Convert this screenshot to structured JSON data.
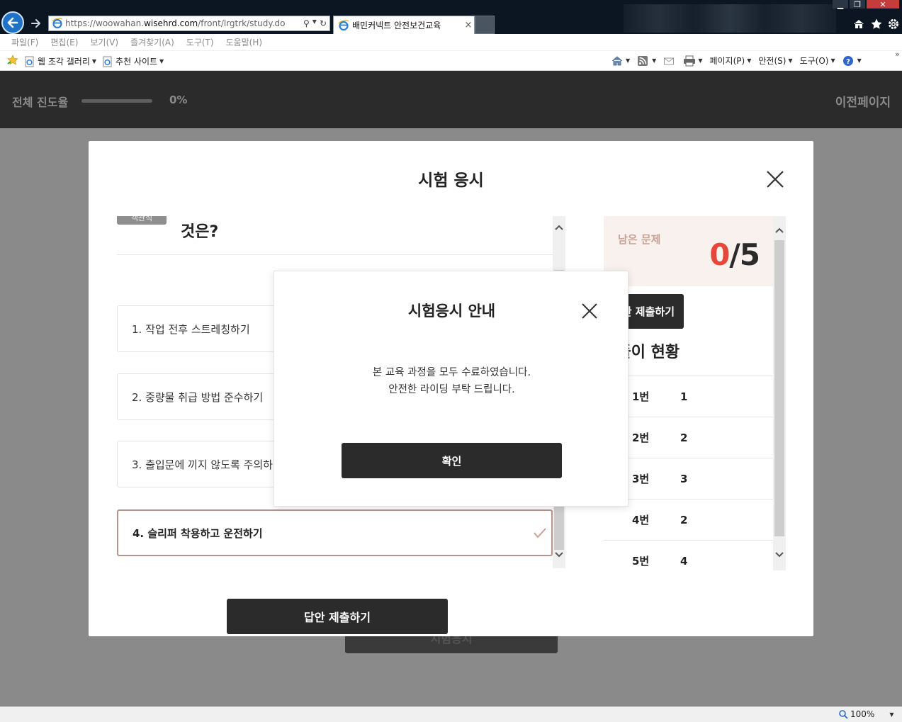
{
  "browser": {
    "url_prefix": "https://woowahan.",
    "url_domain": "wisehrd.com",
    "url_path": "/front/lrgtrk/study.do",
    "tab_title": "배민커넥트 안전보건교육",
    "tab_close": "×",
    "menu": [
      "파일(F)",
      "편집(E)",
      "보기(V)",
      "즐겨찾기(A)",
      "도구(T)",
      "도움말(H)"
    ],
    "favorites": [
      "웹 조각 갤러리",
      "추천 사이트"
    ],
    "commands": [
      "페이지(P)",
      "안전(S)",
      "도구(O)"
    ],
    "zoom": "100%"
  },
  "header": {
    "progress_label": "전체 진도율",
    "progress_percent": 0,
    "progress_text": "0%",
    "prev_page": "이전페이지"
  },
  "background": {
    "exam_button": "시험응시"
  },
  "exam_modal": {
    "title": "시험 응시",
    "question_badge": "객관식",
    "question_text": "것은?",
    "choices": [
      "1. 작업 전후 스트레칭하기",
      "2. 중량물 취급 방법 준수하기",
      "3. 출입문에 끼지 않도록 주의하기",
      "4. 슬리퍼 착용하고 운전하기"
    ],
    "selected_choice": 4,
    "submit_label": "답안 제출하기",
    "side": {
      "remaining_label": "남은 문제",
      "remaining_done": "0",
      "remaining_total": "/5",
      "submit_label": "답안 제출하기",
      "heading": "문제풀이 현황",
      "answers": [
        {
          "num": "1번",
          "val": "1"
        },
        {
          "num": "2번",
          "val": "2"
        },
        {
          "num": "3번",
          "val": "3"
        },
        {
          "num": "4번",
          "val": "2"
        },
        {
          "num": "5번",
          "val": "4"
        }
      ]
    }
  },
  "notice": {
    "title": "시험응시 안내",
    "line1": "본 교육 과정을 모두 수료하였습니다.",
    "line2": "안전한 라이딩 부탁 드립니다.",
    "ok": "확인"
  },
  "colors": {
    "accent_red": "#e7473b",
    "selected_border": "#b8968e",
    "dark_button": "#2b2b2b"
  }
}
